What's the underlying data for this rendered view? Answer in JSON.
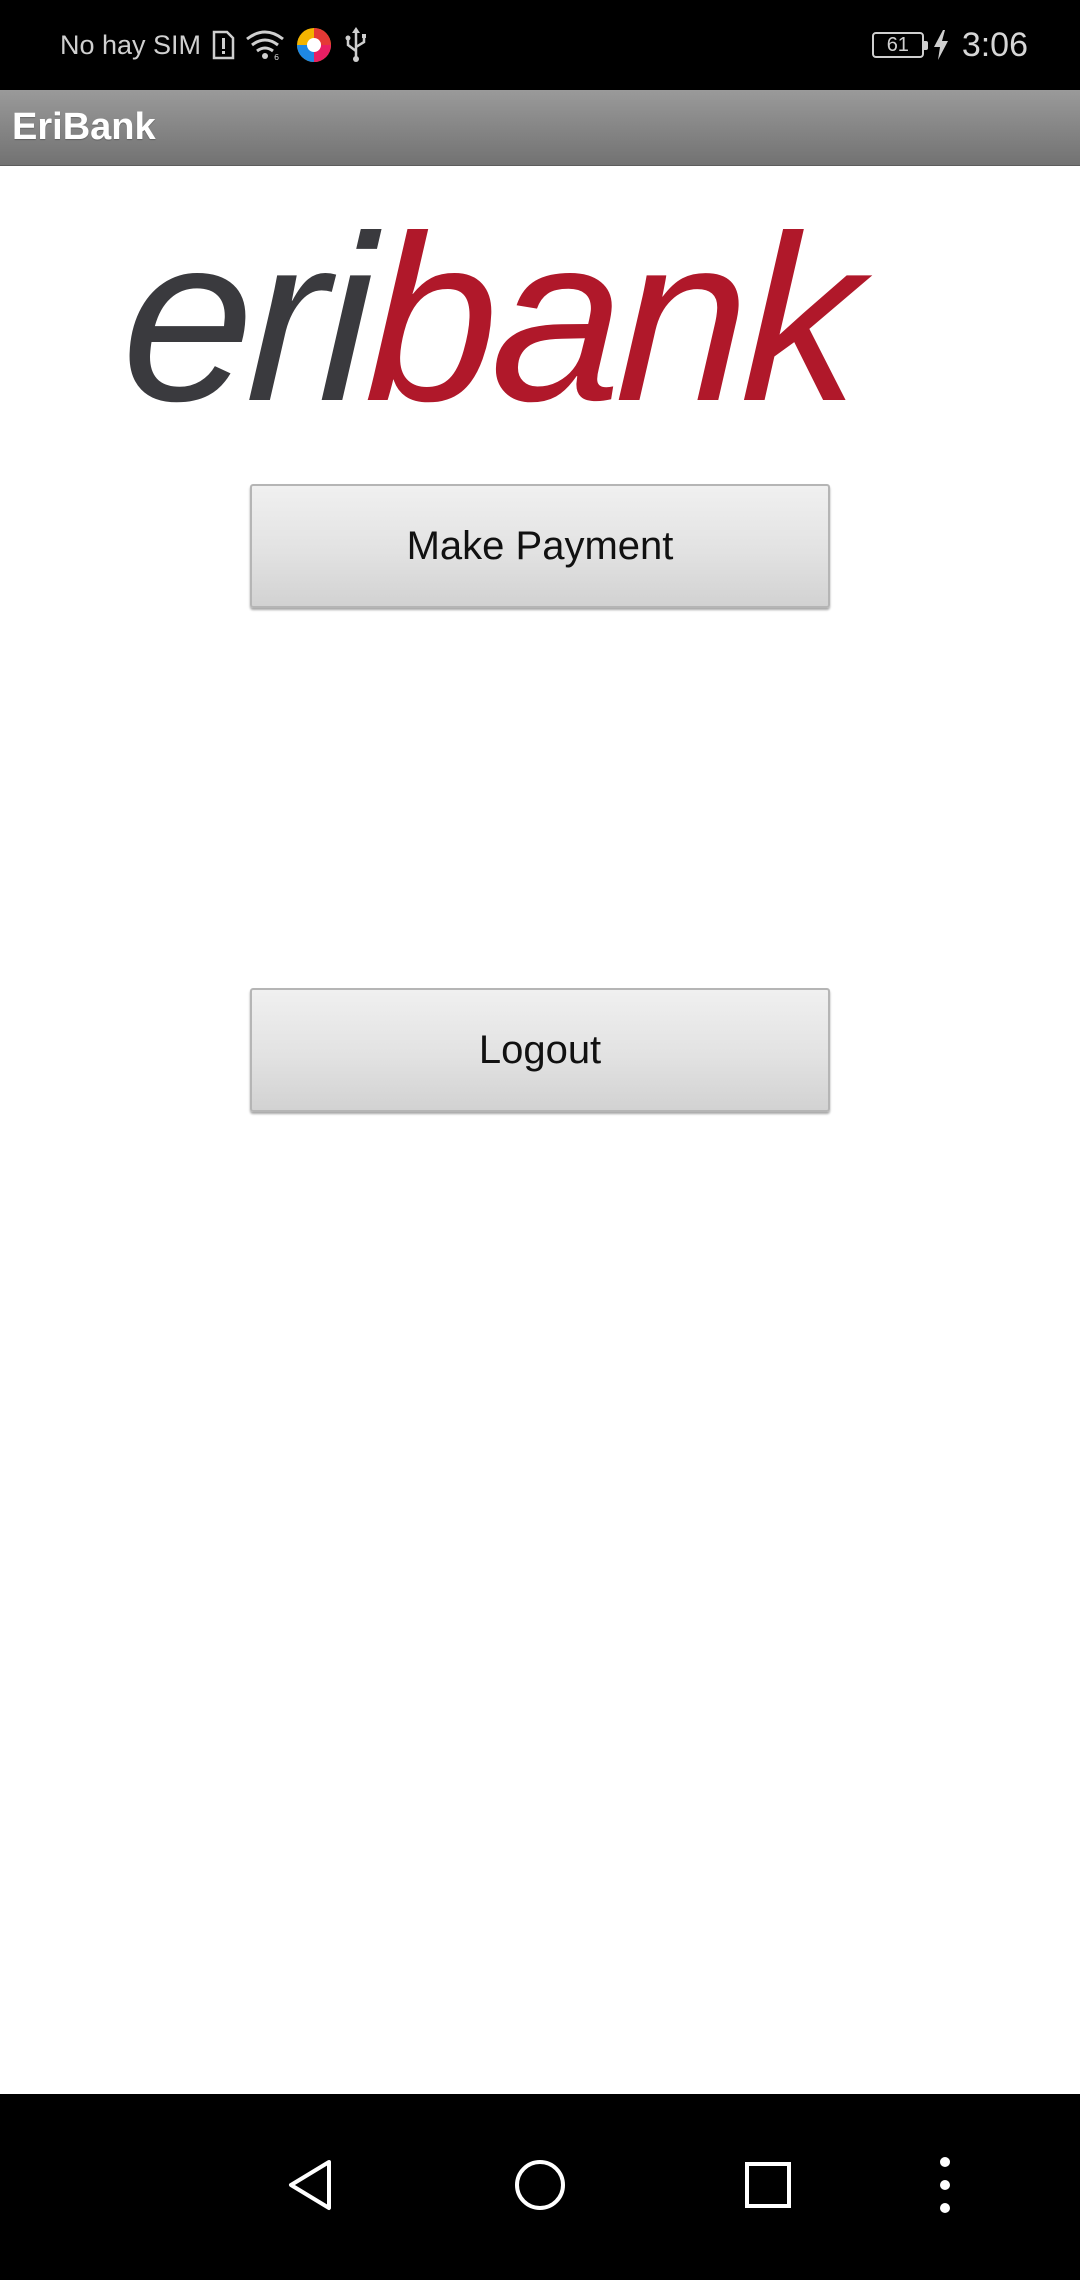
{
  "status_bar": {
    "carrier": "No hay SIM",
    "battery_level": "61",
    "time": "3:06",
    "icons": [
      "sim-alert-icon",
      "wifi-icon",
      "app-notification-icon",
      "usb-icon",
      "battery-icon",
      "charging-icon"
    ]
  },
  "app_bar": {
    "title": "EriBank"
  },
  "logo": {
    "part1": "eri",
    "part2": "bank",
    "colors": {
      "eri": "#3a3a3e",
      "bank": "#b0182a"
    }
  },
  "buttons": {
    "make_payment": "Make Payment",
    "logout": "Logout"
  },
  "nav_bar": {
    "icons": [
      "back-icon",
      "home-icon",
      "recents-icon",
      "more-options-icon"
    ]
  }
}
